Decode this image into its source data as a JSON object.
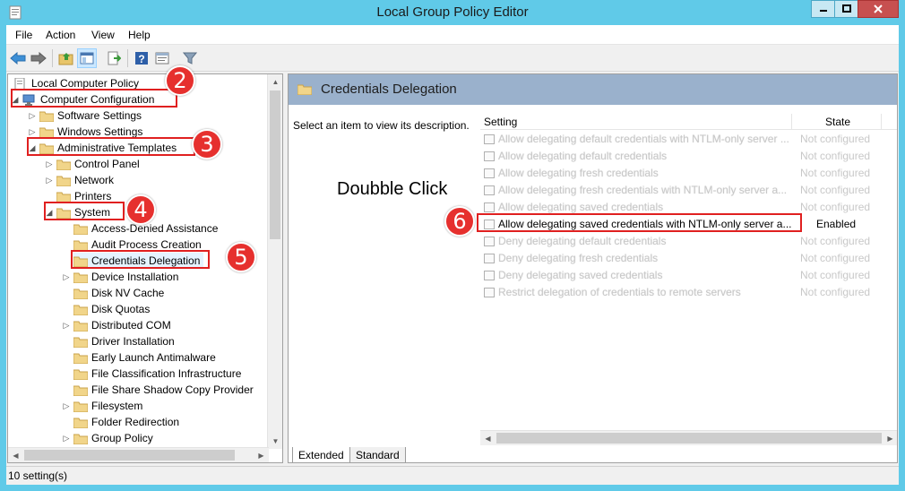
{
  "window": {
    "title": "Local Group Policy Editor"
  },
  "menu": [
    "File",
    "Action",
    "View",
    "Help"
  ],
  "toolbar": {
    "icons": [
      "back-icon",
      "forward-icon",
      "up-folder-icon",
      "show-hide-tree-icon",
      "export-list-icon",
      "help-icon",
      "properties-icon",
      "filter-icon"
    ]
  },
  "tree": {
    "items": [
      {
        "label": "Local Computer Policy"
      },
      {
        "label": "Computer Configuration"
      },
      {
        "label": "Software Settings"
      },
      {
        "label": "Windows Settings"
      },
      {
        "label": "Administrative Templates"
      },
      {
        "label": "Control Panel"
      },
      {
        "label": "Network"
      },
      {
        "label": "Printers"
      },
      {
        "label": "System"
      },
      {
        "label": "Access-Denied Assistance"
      },
      {
        "label": "Audit Process Creation"
      },
      {
        "label": "Credentials Delegation"
      },
      {
        "label": "Device Installation"
      },
      {
        "label": "Disk NV Cache"
      },
      {
        "label": "Disk Quotas"
      },
      {
        "label": "Distributed COM"
      },
      {
        "label": "Driver Installation"
      },
      {
        "label": "Early Launch Antimalware"
      },
      {
        "label": "File Classification Infrastructure"
      },
      {
        "label": "File Share Shadow Copy Provider"
      },
      {
        "label": "Filesystem"
      },
      {
        "label": "Folder Redirection"
      },
      {
        "label": "Group Policy"
      }
    ]
  },
  "details": {
    "header_title": "Credentials Delegation",
    "description": "Select an item to view its description.",
    "columns": {
      "setting": "Setting",
      "state": "State"
    },
    "rows": [
      {
        "setting": "Allow delegating default credentials with NTLM-only server ...",
        "state": "Not configured"
      },
      {
        "setting": "Allow delegating default credentials",
        "state": "Not configured"
      },
      {
        "setting": "Allow delegating fresh credentials",
        "state": "Not configured"
      },
      {
        "setting": "Allow delegating fresh credentials with NTLM-only server a...",
        "state": "Not configured"
      },
      {
        "setting": "Allow delegating saved credentials",
        "state": "Not configured"
      },
      {
        "setting": "Allow delegating saved credentials with NTLM-only server a...",
        "state": "Enabled"
      },
      {
        "setting": "Deny delegating default credentials",
        "state": "Not configured"
      },
      {
        "setting": "Deny delegating fresh credentials",
        "state": "Not configured"
      },
      {
        "setting": "Deny delegating saved credentials",
        "state": "Not configured"
      },
      {
        "setting": "Restrict delegation of credentials to remote servers",
        "state": "Not configured"
      }
    ],
    "tabs": [
      "Extended",
      "Standard"
    ]
  },
  "annotations": {
    "doubble_click": "Doubble Click",
    "steps": [
      "2",
      "3",
      "4",
      "5",
      "6"
    ]
  },
  "status": {
    "text": "10 setting(s)"
  },
  "colors": {
    "titlebar": "#60cae8",
    "header": "#9ab1cc",
    "annotation": "#e02020"
  }
}
